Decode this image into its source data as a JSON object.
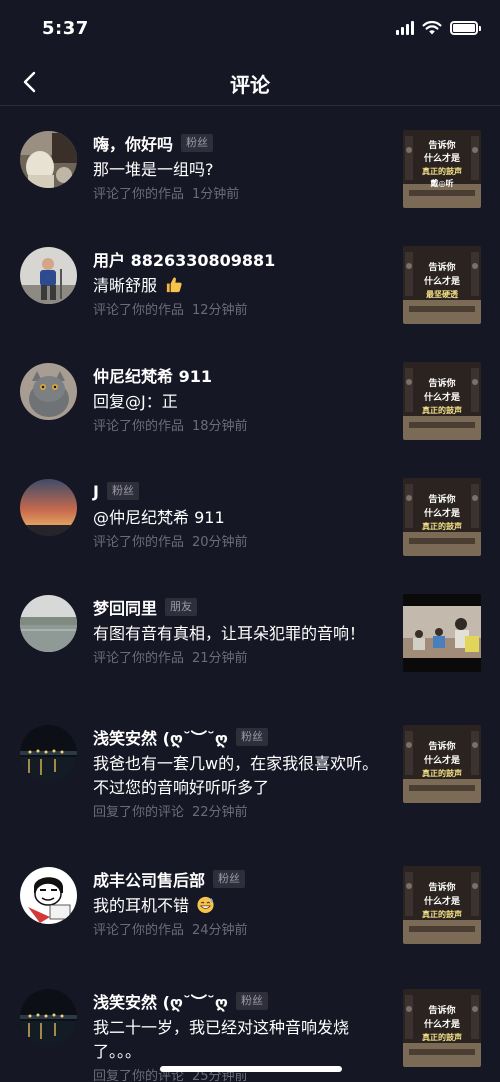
{
  "status_bar": {
    "time": "5:37"
  },
  "nav": {
    "title": "评论",
    "back_icon": "chevron-left-icon"
  },
  "comments": [
    {
      "username": "嗨，你好吗",
      "tag": "粉丝",
      "text": "那一堆是一组吗?",
      "emoji": "",
      "action": "评论了你的作品",
      "time": "1分钟前",
      "thumb_lines": [
        "告诉你",
        "什么才是",
        "真正的鼓声",
        "戴◎听"
      ]
    },
    {
      "username": "用户 8826330809881",
      "tag": "",
      "text": "清晰舒服",
      "emoji": "thumbs-up",
      "action": "评论了你的作品",
      "time": "12分钟前",
      "thumb_lines": [
        "告诉你",
        "什么才是",
        "最坚硬透"
      ]
    },
    {
      "username": "仲尼纪梵希 911",
      "tag": "",
      "text": "回复@J：正",
      "emoji": "",
      "action": "评论了你的作品",
      "time": "18分钟前",
      "thumb_lines": [
        "告诉你",
        "什么才是",
        "真正的鼓声"
      ]
    },
    {
      "username": "J",
      "tag": "粉丝",
      "text": "@仲尼纪梵希 911",
      "emoji": "",
      "action": "评论了你的作品",
      "time": "20分钟前",
      "thumb_lines": [
        "告诉你",
        "什么才是",
        "真正的鼓声"
      ]
    },
    {
      "username": "梦回同里",
      "tag": "朋友",
      "text": "有图有音有真相，让耳朵犯罪的音响！",
      "emoji": "",
      "action": "评论了你的作品",
      "time": "21分钟前",
      "thumb_lines": []
    },
    {
      "username": "浅笑安然 (ღ˘︶˘ღ",
      "tag": "粉丝",
      "text": "我爸也有一套几w的，在家我很喜欢听。不过您的音响好听听多了",
      "emoji": "",
      "action": "回复了你的评论",
      "time": "22分钟前",
      "thumb_lines": [
        "告诉你",
        "什么才是",
        "真正的鼓声"
      ]
    },
    {
      "username": "成丰公司售后部",
      "tag": "粉丝",
      "text": "我的耳机不错",
      "emoji": "grin-sweat",
      "action": "评论了你的作品",
      "time": "24分钟前",
      "thumb_lines": [
        "告诉你",
        "什么才是",
        "真正的鼓声"
      ]
    },
    {
      "username": "浅笑安然 (ღ˘︶˘ღ",
      "tag": "粉丝",
      "text": "我二十一岁，我已经对这种音响发烧了。。。",
      "emoji": "",
      "action": "回复了你的评论",
      "time": "25分钟前",
      "thumb_lines": [
        "告诉你",
        "什么才是",
        "真正的鼓声"
      ]
    }
  ],
  "colors": {
    "background": "#161724",
    "meta": "#6b6c78",
    "tag_bg": "#2e2f3b",
    "thumb_text_yellow": "#f3e08a"
  }
}
